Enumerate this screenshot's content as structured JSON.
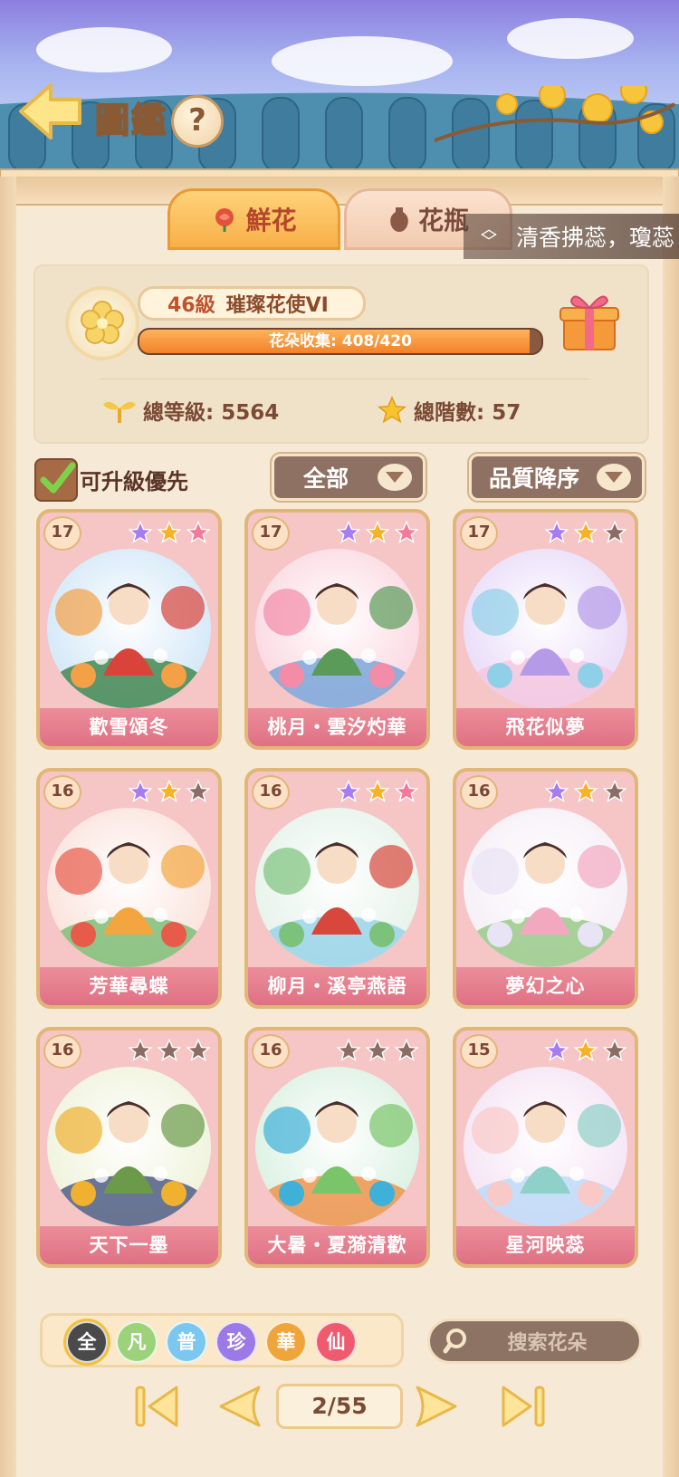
{
  "header": {
    "title": "圖鑑",
    "help_label": "?"
  },
  "tabs": [
    {
      "label": "鮮花",
      "active": true
    },
    {
      "label": "花瓶",
      "active": false
    }
  ],
  "ticker": {
    "text": "清香拂蕊，瓊蕊"
  },
  "level_panel": {
    "level": "46級",
    "rank": "璀璨花使VI",
    "progress_text": "花朵收集: 408/420",
    "progress_fraction": 0.971,
    "total_level": "總等級: 5564",
    "total_stage": "總階數: 57"
  },
  "filters": {
    "upgrade_first_label": "可升級優先",
    "upgrade_first_checked": true,
    "category": "全部",
    "sort": "品質降序"
  },
  "cards": [
    {
      "level": "17",
      "name": "歡雪頌冬",
      "stars": [
        "purple",
        "gold",
        "pink"
      ],
      "theme": "snow"
    },
    {
      "level": "17",
      "name": "桃月・雲汐灼華",
      "stars": [
        "purple",
        "gold",
        "pink"
      ],
      "theme": "peach"
    },
    {
      "level": "17",
      "name": "飛花似夢",
      "stars": [
        "purple",
        "gold",
        "grey"
      ],
      "theme": "dream"
    },
    {
      "level": "16",
      "name": "芳華尋蝶",
      "stars": [
        "purple",
        "gold",
        "grey"
      ],
      "theme": "butterfly"
    },
    {
      "level": "16",
      "name": "柳月・溪亭燕語",
      "stars": [
        "purple",
        "gold",
        "pink"
      ],
      "theme": "willow"
    },
    {
      "level": "16",
      "name": "夢幻之心",
      "stars": [
        "purple",
        "gold",
        "grey"
      ],
      "theme": "heart"
    },
    {
      "level": "16",
      "name": "天下一墨",
      "stars": [
        "grey",
        "grey",
        "grey"
      ],
      "theme": "ink"
    },
    {
      "level": "16",
      "name": "大暑・夏漪清歡",
      "stars": [
        "grey",
        "grey",
        "grey"
      ],
      "theme": "summer"
    },
    {
      "level": "15",
      "name": "星河映蕊",
      "stars": [
        "purple",
        "gold",
        "grey"
      ],
      "theme": "galaxy"
    }
  ],
  "rarity_filters": [
    {
      "label": "全",
      "color": "#4a4a4a"
    },
    {
      "label": "凡",
      "color": "#9bd27a"
    },
    {
      "label": "普",
      "color": "#7cc7ee"
    },
    {
      "label": "珍",
      "color": "#9b79e6"
    },
    {
      "label": "華",
      "color": "#f0a53a"
    },
    {
      "label": "仙",
      "color": "#ef5a6f"
    }
  ],
  "search": {
    "placeholder": "搜索花朵"
  },
  "pagination": {
    "current": "2/55"
  },
  "colors": {
    "star_purple": "#a77cf0",
    "star_gold": "#f7b325",
    "star_pink": "#f27a9b",
    "star_grey": "#8a6e66",
    "card_bg": "#f6c5c6",
    "name_band": "#e27b8c"
  }
}
